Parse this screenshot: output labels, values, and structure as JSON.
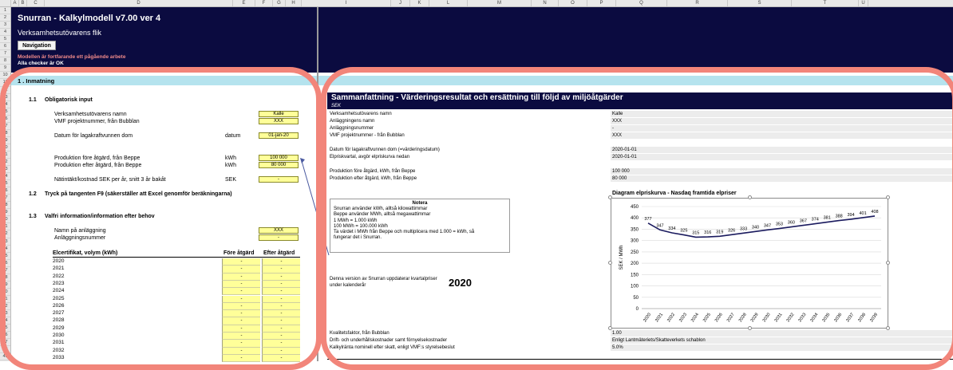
{
  "colors": {
    "navy": "#0b0b40",
    "input_yellow": "#ffff99",
    "section_cyan": "#b5e3ee",
    "highlight_circle": "#f2857a",
    "warning_text": "#f08a8a"
  },
  "column_headers": [
    "A",
    "B",
    "C",
    "D",
    "E",
    "F",
    "G",
    "H",
    "I",
    "J",
    "K",
    "L",
    "M",
    "N",
    "O",
    "P",
    "Q",
    "R",
    "S",
    "T",
    "U"
  ],
  "row_numbers": [
    "1",
    "2",
    "3",
    "4",
    "5",
    "6",
    "7",
    "8",
    "9",
    "10",
    "11",
    "12",
    "13",
    "14",
    "15",
    "16",
    "17",
    "18",
    "19",
    "20",
    "21",
    "22",
    "23",
    "24",
    "25",
    "26",
    "27",
    "28",
    "29",
    "30",
    "31",
    "32",
    "33",
    "34",
    "35",
    "36",
    "37",
    "38",
    "39",
    "40",
    "41",
    "42",
    "43",
    "44",
    "45",
    "46",
    "47",
    "48",
    "49"
  ],
  "header": {
    "title": "Snurran - Kalkylmodell v7.00 ver 4",
    "subtitle": "Verksamhetsutövarens flik",
    "nav_button": "Navigation",
    "warning1": "Modellen är fortfarande ett pågående arbete",
    "warning2": "Alla checker är OK"
  },
  "left": {
    "section": "1 . Inmatning",
    "s11": "1.1",
    "s11_title": "Obligatorisk input",
    "f_name": "Verksamhetsutövarens namn",
    "v_name": "Kalle",
    "f_vmf": "VMF projektnummer, från Bubblan",
    "v_vmf": "XXX",
    "f_datum": "Datum för lagakraftvunnen dom",
    "u_datum": "datum",
    "v_datum": "01-jan-20",
    "f_prod_fore": "Produktion före åtgärd, från Beppe",
    "u_prod_fore": "kWh",
    "v_prod_fore": "100 000",
    "f_prod_efter": "Produktion efter åtgärd, från Beppe",
    "u_prod_efter": "kWh",
    "v_prod_efter": "80 000",
    "f_nat": "Nätintäkt/kostnad SEK per år, snitt 3 år bakåt",
    "u_nat": "SEK",
    "v_nat": "-",
    "s12": "1.2",
    "s12_title": "Tryck på tangenten F9 (säkerställer att Excel genomför beräkningarna)",
    "s13": "1.3",
    "s13_title": "Valfri information/information efter behov",
    "f_anl": "Namn på anläggning",
    "v_anl": "XXX",
    "f_anlnr": "Anläggningsnummer",
    "v_anlnr": "-",
    "tbl_head": "Elcertifikat, volym (kWh)",
    "tbl_fore": "Före åtgärd",
    "tbl_efter": "Efter åtgärd",
    "years": [
      {
        "year": "2020",
        "fore": "-",
        "efter": "-"
      },
      {
        "year": "2021",
        "fore": "-",
        "efter": "-"
      },
      {
        "year": "2022",
        "fore": "-",
        "efter": "-"
      },
      {
        "year": "2023",
        "fore": "-",
        "efter": "-"
      },
      {
        "year": "2024",
        "fore": "-",
        "efter": "-"
      },
      {
        "year": "2025",
        "fore": "-",
        "efter": "-"
      },
      {
        "year": "2026",
        "fore": "-",
        "efter": "-"
      },
      {
        "year": "2027",
        "fore": "-",
        "efter": "-"
      },
      {
        "year": "2028",
        "fore": "-",
        "efter": "-"
      },
      {
        "year": "2029",
        "fore": "-",
        "efter": "-"
      },
      {
        "year": "2030",
        "fore": "-",
        "efter": "-"
      },
      {
        "year": "2031",
        "fore": "-",
        "efter": "-"
      },
      {
        "year": "2032",
        "fore": "-",
        "efter": "-"
      },
      {
        "year": "2033",
        "fore": "-",
        "efter": "-"
      }
    ]
  },
  "right": {
    "title": "Sammanfattning - Värderingsresultat och ersättning till följd av miljöåtgärder",
    "sub": "SEK",
    "rows": [
      {
        "label": "Verksamhetsutövarens namn",
        "value": "Kalle"
      },
      {
        "label": "Anläggningens namn",
        "value": "XXX"
      },
      {
        "label": "Anläggningsnummer",
        "value": "-"
      },
      {
        "label": "VMF projektnummer - från Bubblan",
        "value": "XXX"
      },
      {
        "label": "Datum för lagakraftvunnen dom (=värderingsdatum)",
        "value": "2020-01-01"
      },
      {
        "label": "Elpriskvartal, avgör elpriskurva nedan",
        "value": "2020-01-01"
      },
      {
        "label": "Produktion före åtgärd, kWh, från Beppe",
        "value": "100 000"
      },
      {
        "label": "Produktion efter åtgärd, kWh, från Beppe",
        "value": "80 000"
      }
    ],
    "notera": {
      "title": "Notera",
      "lines": [
        "Snurran använder kWh, alltså kilowattimmar",
        "Beppe använder MWh, alltså megawattimmar",
        "1 MWh = 1.000 kWh",
        "100 MWh = 100.000 kWh",
        "Ta värdet i MWh från Beppe och multiplicera med 1.000 = kWh, så",
        "fungerar det i Snurran."
      ]
    },
    "version_text1": "Denna version av Snurran uppdaterar kvartalpriser",
    "version_text2": "under kalenderår",
    "version_year": "2020",
    "bottom_rows": [
      {
        "label": "Kvalitetsfaktor, från Bubblan",
        "value": "1.00"
      },
      {
        "label": "Drift- och underhållskostnader samt förnyelsekostnader",
        "value": "Enligt Lantmäteriets/Skatteverkets schablon"
      },
      {
        "label": "Kalkylränta nominell efter skatt, enligt VMF:s styrelsebeslut",
        "value": "5.0%"
      }
    ],
    "chart_title": "Diagram elpriskurva - Nasdaq framtida elpriser"
  },
  "chart_data": {
    "type": "line",
    "title": "Diagram elpriskurva - Nasdaq framtida elpriser",
    "ylabel": "SEK / MWh",
    "xlabel": "",
    "x": [
      "2020",
      "2021",
      "2022",
      "2023",
      "2024",
      "2025",
      "2026",
      "2027",
      "2028",
      "2029",
      "2030",
      "2031",
      "2032",
      "2033",
      "2034",
      "2035",
      "2036",
      "2037",
      "2038",
      "2039"
    ],
    "values": [
      377,
      347,
      334,
      325,
      315,
      316,
      319,
      326,
      333,
      340,
      347,
      353,
      360,
      367,
      374,
      381,
      388,
      394,
      401,
      408
    ],
    "ylim": [
      0,
      450
    ],
    "yticks": [
      "0",
      "50",
      "100",
      "150",
      "200",
      "250",
      "300",
      "350",
      "400",
      "450"
    ],
    "grid": true,
    "line_color": "#1a1a5e"
  }
}
